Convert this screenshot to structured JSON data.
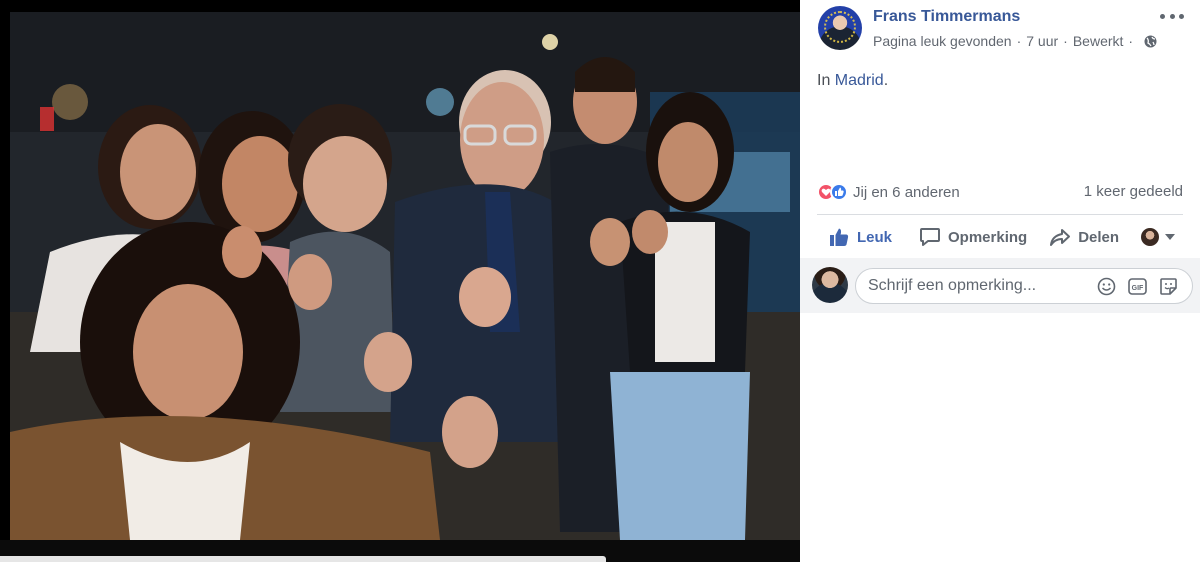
{
  "post": {
    "page_name": "Frans Timmermans",
    "meta": [
      "Pagina leuk gevonden",
      "7 uur",
      "Bewerkt"
    ],
    "text_prefix": "In ",
    "location": "Madrid",
    "text_suffix": "."
  },
  "reactions": {
    "icons": [
      "love-icon",
      "like-icon"
    ],
    "summary": "Jij en 6 anderen",
    "shares": "1 keer gedeeld"
  },
  "actions": {
    "like": "Leuk",
    "comment": "Opmerking",
    "share": "Delen"
  },
  "comment": {
    "placeholder": "Schrijf een opmerking...",
    "icons": [
      "emoji-icon",
      "gif-icon",
      "sticker-icon"
    ]
  },
  "colors": {
    "link": "#385898",
    "accent": "#4267b2",
    "love": "#f25268",
    "like": "#3b7bea",
    "muted": "#616770"
  }
}
